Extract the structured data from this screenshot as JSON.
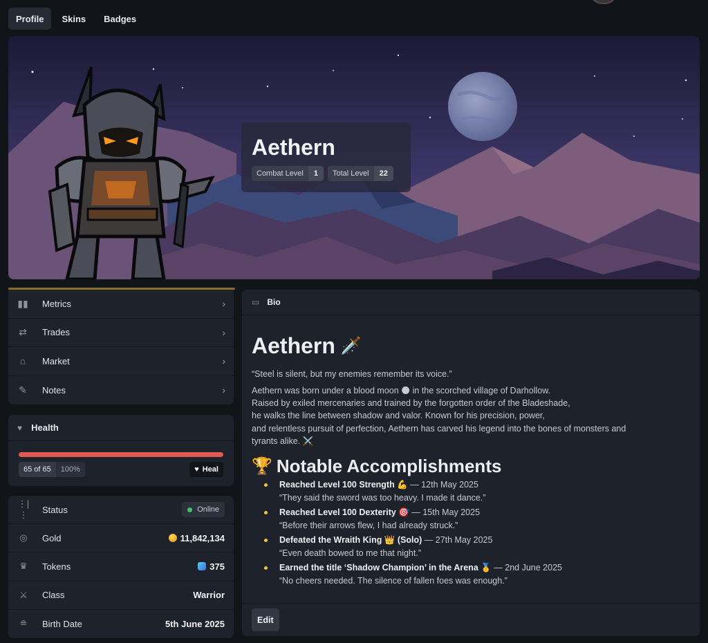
{
  "tabs": [
    {
      "label": "Profile",
      "active": true
    },
    {
      "label": "Skins",
      "active": false
    },
    {
      "label": "Badges",
      "active": false
    }
  ],
  "banner": {
    "name": "Aethern",
    "combat_level_label": "Combat Level",
    "combat_level_value": "1",
    "total_level_label": "Total Level",
    "total_level_value": "22"
  },
  "menu": [
    {
      "label": "Metrics",
      "icon": "bar-chart-icon"
    },
    {
      "label": "Trades",
      "icon": "swap-arrows-icon"
    },
    {
      "label": "Market",
      "icon": "storefront-icon"
    },
    {
      "label": "Notes",
      "icon": "edit-note-icon"
    }
  ],
  "health": {
    "title": "Health",
    "current_text": "65 of 65",
    "percent_text": "100%",
    "percent": 100,
    "heal_label": "Heal"
  },
  "stats": {
    "status_label": "Status",
    "status_value": "Online",
    "gold_label": "Gold",
    "gold_value": "11,842,134",
    "tokens_label": "Tokens",
    "tokens_value": "375",
    "class_label": "Class",
    "class_value": "Warrior",
    "birth_label": "Birth Date",
    "birth_value": "5th June 2025"
  },
  "bio": {
    "header": "Bio",
    "title": "Aethern",
    "title_emoji": "🗡️",
    "quote": "“Steel is silent, but my enemies remember its voice.”",
    "story_lines": [
      "Aethern was born under a blood moon 🌑 in the scorched village of Darhollow.",
      "Raised by exiled mercenaries and trained by the forgotten order of the Bladeshade,",
      "he walks the line between shadow and valor. Known for his precision, power,",
      "and relentless pursuit of perfection, Aethern has carved his legend into the bones of monsters and",
      "tyrants alike. ⚔️"
    ],
    "accomplishments_title": "Notable Accomplishments",
    "accomplishments_emoji": "🏆",
    "accomplishments": [
      {
        "title": "Reached Level 100 Strength 💪",
        "date": " — 12th May 2025",
        "quote": "“They said the sword was too heavy. I made it dance.”"
      },
      {
        "title": "Reached Level 100 Dexterity 🎯",
        "date": " — 15th May 2025",
        "quote": "“Before their arrows flew, I had already struck.”"
      },
      {
        "title": "Defeated the Wraith King 👑 (Solo)",
        "date": " — 27th May 2025",
        "quote": "“Even death bowed to me that night.”"
      },
      {
        "title": "Earned the title ‘Shadow Champion’ in the Arena 🥇",
        "date": " — 2nd June 2025",
        "quote": "“No cheers needed. The silence of fallen foes was enough.”"
      }
    ],
    "edit_label": "Edit"
  }
}
